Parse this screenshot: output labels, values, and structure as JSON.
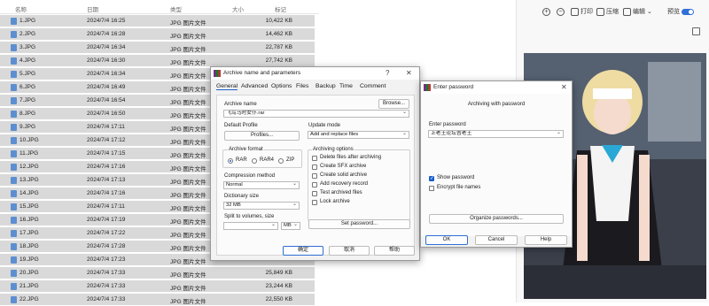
{
  "filelist": {
    "headers": {
      "name": "名称",
      "date": "日期",
      "type": "类型",
      "size": "大小",
      "tag": "标记"
    },
    "rows": [
      {
        "name": "1.JPG",
        "date": "2024/7/4 16:25",
        "type": "JPG 图片文件",
        "size": "10,422 KB"
      },
      {
        "name": "2.JPG",
        "date": "2024/7/4 16:28",
        "type": "JPG 图片文件",
        "size": "14,462 KB"
      },
      {
        "name": "3.JPG",
        "date": "2024/7/4 16:34",
        "type": "JPG 图片文件",
        "size": "22,787 KB"
      },
      {
        "name": "4.JPG",
        "date": "2024/7/4 16:30",
        "type": "JPG 图片文件",
        "size": "27,742 KB"
      },
      {
        "name": "5.JPG",
        "date": "2024/7/4 16:34",
        "type": "JPG 图片文件",
        "size": ""
      },
      {
        "name": "6.JPG",
        "date": "2024/7/4 16:49",
        "type": "JPG 图片文件",
        "size": ""
      },
      {
        "name": "7.JPG",
        "date": "2024/7/4 16:54",
        "type": "JPG 图片文件",
        "size": ""
      },
      {
        "name": "8.JPG",
        "date": "2024/7/4 16:50",
        "type": "JPG 图片文件",
        "size": ""
      },
      {
        "name": "9.JPG",
        "date": "2024/7/4 17:11",
        "type": "JPG 图片文件",
        "size": ""
      },
      {
        "name": "10.JPG",
        "date": "2024/7/4 17:12",
        "type": "JPG 图片文件",
        "size": ""
      },
      {
        "name": "11.JPG",
        "date": "2024/7/4 17:15",
        "type": "JPG 图片文件",
        "size": ""
      },
      {
        "name": "12.JPG",
        "date": "2024/7/4 17:16",
        "type": "JPG 图片文件",
        "size": ""
      },
      {
        "name": "13.JPG",
        "date": "2024/7/4 17:13",
        "type": "JPG 图片文件",
        "size": ""
      },
      {
        "name": "14.JPG",
        "date": "2024/7/4 17:16",
        "type": "JPG 图片文件",
        "size": ""
      },
      {
        "name": "15.JPG",
        "date": "2024/7/4 17:11",
        "type": "JPG 图片文件",
        "size": ""
      },
      {
        "name": "16.JPG",
        "date": "2024/7/4 17:19",
        "type": "JPG 图片文件",
        "size": ""
      },
      {
        "name": "17.JPG",
        "date": "2024/7/4 17:22",
        "type": "JPG 图片文件",
        "size": ""
      },
      {
        "name": "18.JPG",
        "date": "2024/7/4 17:28",
        "type": "JPG 图片文件",
        "size": ""
      },
      {
        "name": "19.JPG",
        "date": "2024/7/4 17:23",
        "type": "JPG 图片文件",
        "size": ""
      },
      {
        "name": "20.JPG",
        "date": "2024/7/4 17:33",
        "type": "JPG 图片文件",
        "size": "25,849 KB"
      },
      {
        "name": "21.JPG",
        "date": "2024/7/4 17:33",
        "type": "JPG 图片文件",
        "size": "23,244 KB"
      },
      {
        "name": "22.JPG",
        "date": "2024/7/4 17:33",
        "type": "JPG 图片文件",
        "size": "22,550 KB"
      }
    ]
  },
  "viewer": {
    "print": "打印",
    "compress": "压缩",
    "edit": "编辑",
    "preview": "预览"
  },
  "archive_dialog": {
    "title": "Archive name and parameters",
    "help": "?",
    "close": "✕",
    "tabs": [
      "General",
      "Advanced",
      "Options",
      "Files",
      "Backup",
      "Time",
      "Comment"
    ],
    "archive_name_label": "Archive name",
    "archive_name_value": "飞鸟马时女仆.rar",
    "browse": "Browse...",
    "default_profile_label": "Default Profile",
    "profiles": "Profiles...",
    "update_mode_label": "Update mode",
    "update_mode_value": "Add and replace files",
    "archive_format_label": "Archive format",
    "formats": [
      "RAR",
      "RAR4",
      "ZIP"
    ],
    "compression_label": "Compression method",
    "compression_value": "Normal",
    "dictionary_label": "Dictionary size",
    "dictionary_value": "32 MB",
    "split_label": "Split to volumes, size",
    "split_value": "",
    "split_unit": "MB",
    "options_label": "Archiving options",
    "options": [
      "Delete files after archiving",
      "Create SFX archive",
      "Create solid archive",
      "Add recovery record",
      "Test archived files",
      "Lock archive"
    ],
    "set_password": "Set password...",
    "ok": "确定",
    "cancel": "取消",
    "helpbtn": "帮助"
  },
  "password_dialog": {
    "title": "Enter password",
    "close": "✕",
    "heading": "Archiving with password",
    "enter_label": "Enter password",
    "password_value": "上老王论坛吉老王",
    "show_password": "Show password",
    "encrypt_names": "Encrypt file names",
    "organize": "Organize passwords...",
    "ok": "OK",
    "cancel": "Cancel",
    "help": "Help"
  }
}
